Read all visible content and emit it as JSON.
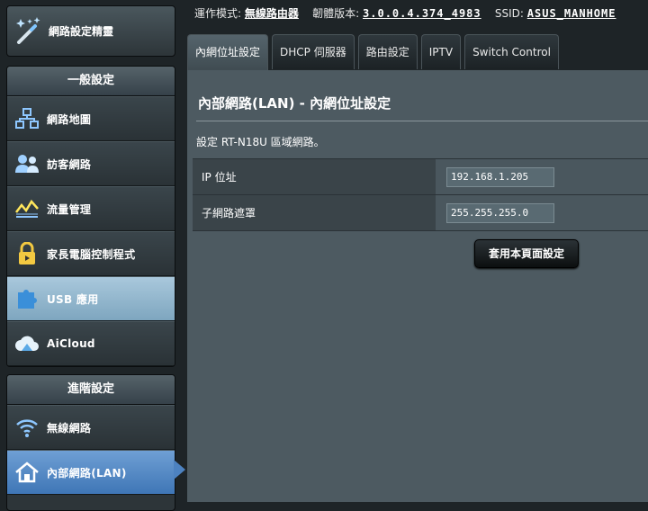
{
  "sidebar": {
    "qis_label": "網路設定精靈",
    "general": {
      "heading": "一般設定",
      "items": [
        {
          "label": "網路地圖",
          "icon": "network-map-icon"
        },
        {
          "label": "訪客網路",
          "icon": "guest-network-icon"
        },
        {
          "label": "流量管理",
          "icon": "traffic-manager-icon"
        },
        {
          "label": "家長電腦控制程式",
          "icon": "parental-control-icon"
        },
        {
          "label": "USB 應用",
          "icon": "usb-application-icon"
        },
        {
          "label": "AiCloud",
          "icon": "aicloud-icon"
        }
      ]
    },
    "advanced": {
      "heading": "進階設定",
      "items": [
        {
          "label": "無線網路",
          "icon": "wireless-icon"
        },
        {
          "label": "內部網路(LAN)",
          "icon": "lan-icon"
        }
      ]
    }
  },
  "topbar": {
    "mode_label": "運作模式:",
    "mode_value": "無線路由器",
    "firmware_label": "韌體版本:",
    "firmware_value": "3.0.0.4.374_4983",
    "ssid_label": "SSID:",
    "ssid_value": "ASUS_MANHOME"
  },
  "tabs": [
    "內網位址設定",
    "DHCP 伺服器",
    "路由設定",
    "IPTV",
    "Switch Control"
  ],
  "main": {
    "title": "內部網路(LAN) - 內網位址設定",
    "description": "設定 RT-N18U 區域網路。",
    "fields": [
      {
        "label": "IP 位址",
        "value": "192.168.1.205"
      },
      {
        "label": "子網路遮罩",
        "value": "255.255.255.0"
      }
    ],
    "apply_label": "套用本頁面設定"
  },
  "colors": {
    "accent": "#4d82c0",
    "usb_highlight": "#9ec0d6",
    "content_bg": "#4d5a61"
  }
}
